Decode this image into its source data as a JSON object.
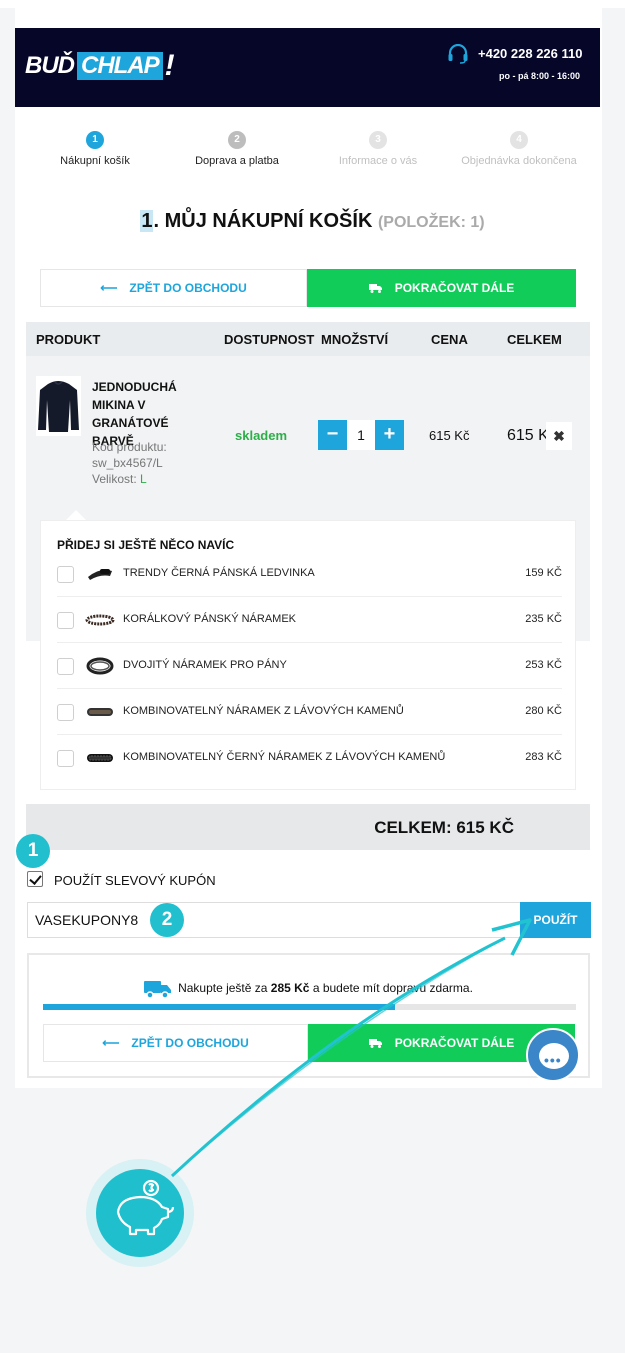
{
  "header": {
    "logo_part1": "BUĎ",
    "logo_part2": "CHLAP",
    "logo_part3": "!",
    "phone": "+420 228 226 110",
    "hours": "po - pá 8:00 - 16:00",
    "brand_color": "#050628"
  },
  "steps": [
    {
      "num": "1",
      "label": "Nákupní košík"
    },
    {
      "num": "2",
      "label": "Doprava a platba"
    },
    {
      "num": "3",
      "label": "Informace o vás"
    },
    {
      "num": "4",
      "label": "Objednávka dokončena"
    }
  ],
  "title": {
    "num": "1",
    "text": ". MŮJ NÁKUPNÍ KOŠÍK",
    "count": "(POLOŽEK: 1)"
  },
  "buttons": {
    "back": "ZPĚT DO OBCHODU",
    "next": "POKRAČOVAT DÁLE"
  },
  "table": {
    "headers": [
      "PRODUKT",
      "DOSTUPNOST",
      "MNOŽSTVÍ",
      "CENA",
      "CELKEM"
    ]
  },
  "product": {
    "name": "JEDNODUCHÁ MIKINA V GRANÁTOVÉ BARVĚ",
    "code_label": "Kód produktu:",
    "code": "sw_bx4567/L",
    "size_label": "Velikost:",
    "size": "L",
    "availability": "skladem",
    "qty_minus": "−",
    "qty": "1",
    "qty_plus": "+",
    "price": "615 Kč",
    "total": "615 Kč",
    "remove": "✖"
  },
  "upsell": {
    "title": "PŘIDEJ SI JEŠTĚ NĚCO NAVÍC",
    "items": [
      {
        "name": "TRENDY ČERNÁ PÁNSKÁ LEDVINKA",
        "price": "159 KČ"
      },
      {
        "name": "KORÁLKOVÝ PÁNSKÝ NÁRAMEK",
        "price": "235 KČ"
      },
      {
        "name": "DVOJITÝ NÁRAMEK PRO PÁNY",
        "price": "253 KČ"
      },
      {
        "name": "KOMBINOVATELNÝ NÁRAMEK Z LÁVOVÝCH KAMENŮ",
        "price": "280 KČ"
      },
      {
        "name": "KOMBINOVATELNÝ ČERNÝ NÁRAMEK Z LÁVOVÝCH KAMENŮ",
        "price": "283 KČ"
      }
    ]
  },
  "summary": {
    "total": "CELKEM: 615 KČ"
  },
  "coupon": {
    "checked": true,
    "label": "POUŽÍT SLEVOVÝ KUPÓN",
    "value": "VASEKUPONY8",
    "apply": "POUŽÍT"
  },
  "shipping": {
    "msg_pre": "Nakupte ještě za ",
    "amount": "285 Kč",
    "msg_post": " a budete mít dopravu zdarma.",
    "progress": 0.66
  },
  "annotations": {
    "badge1": "1",
    "badge2": "2"
  },
  "colors": {
    "accent": "#1ea5dc",
    "success": "#12cc5a",
    "annotation": "#22bfcf"
  },
  "icons": [
    "headset-icon",
    "arrow-left-icon",
    "truck-icon",
    "close-icon",
    "chat-icon",
    "piggy-bank-icon"
  ]
}
